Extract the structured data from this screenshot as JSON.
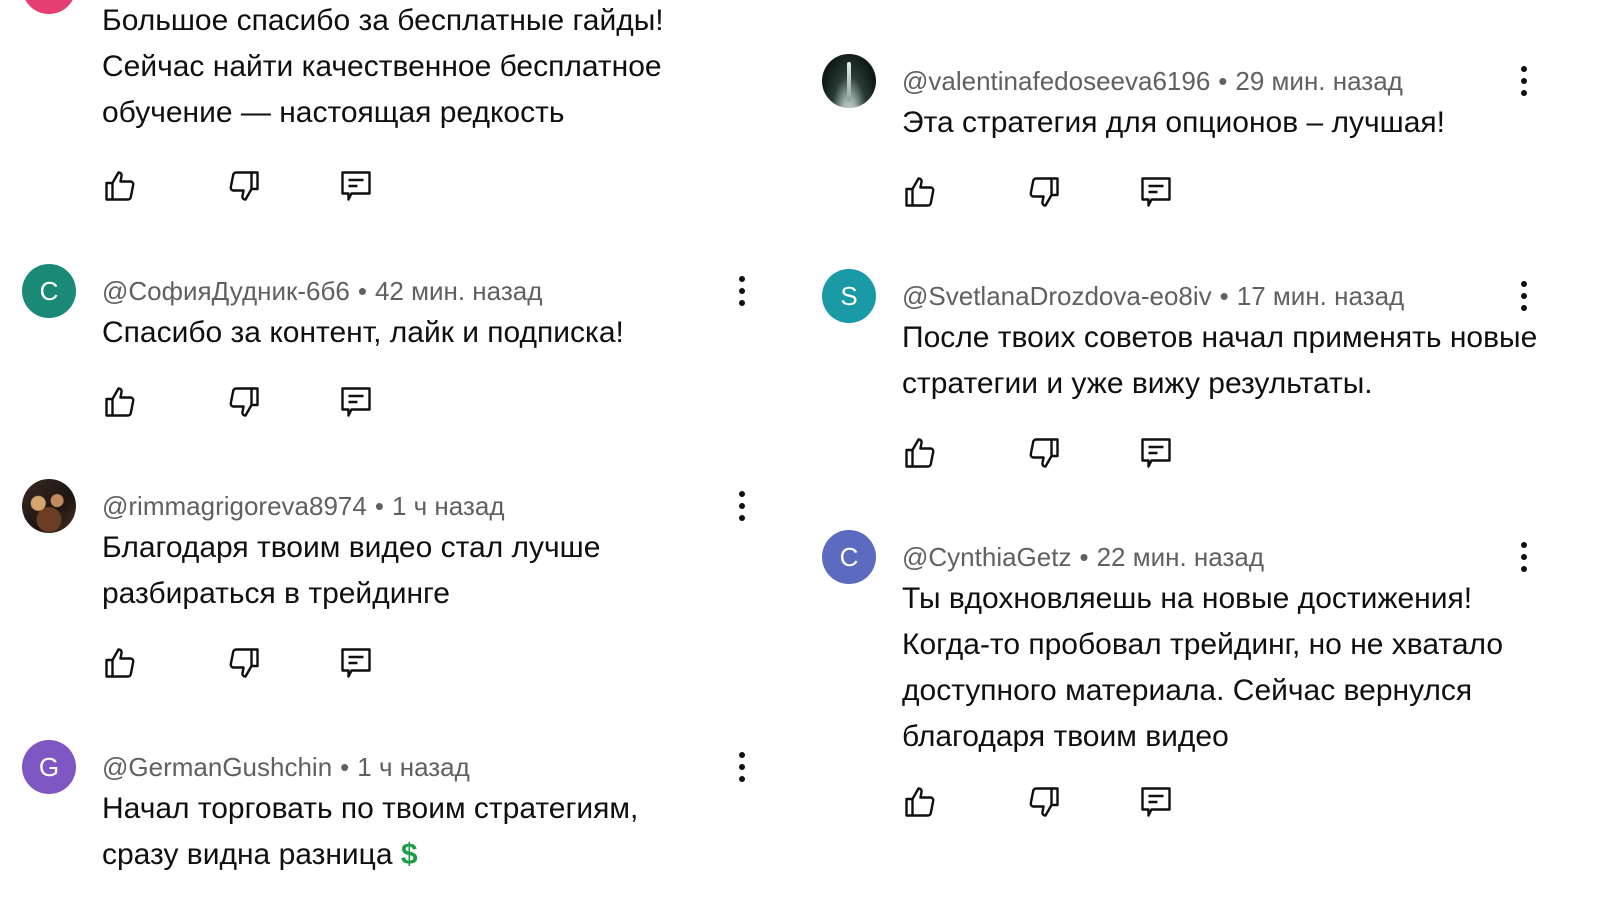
{
  "colors": {
    "avatar_sofia": "#1a8a76",
    "avatar_svetlana": "#1a9aa6",
    "avatar_cynthia": "#5c6bc0",
    "avatar_german": "#7e57c2",
    "avatar_top": "#e53e72"
  },
  "icons": {
    "like": "thumb-up-icon",
    "dislike": "thumb-down-icon",
    "reply": "reply-icon",
    "more": "more-vert-icon"
  },
  "comments_left": [
    {
      "author": "",
      "time": "",
      "avatar_letter": "",
      "text": "Большое спасибо за бесплатные гайды! Сейчас найти качественное бесплатное обучение — настоящая редкость"
    },
    {
      "author": "@СофияДудник-6б6",
      "time": "42 мин. назад",
      "avatar_letter": "С",
      "text": "Спасибо за контент, лайк и подписка!"
    },
    {
      "author": "@rimmagrigoreva8974",
      "time": "1 ч назад",
      "avatar_letter": "",
      "text": "Благодаря твоим видео стал лучше разбираться в трейдинге"
    },
    {
      "author": "@GermanGushchin",
      "time": "1 ч назад",
      "avatar_letter": "G",
      "text": "Начал торговать по твоим стратегиям, сразу видна разница",
      "emoji": "$"
    }
  ],
  "comments_right": [
    {
      "author": "@valentinafedoseeva6196",
      "time": "29 мин. назад",
      "avatar_letter": "",
      "text": "Эта стратегия для опционов – лучшая!"
    },
    {
      "author": "@SvetlanaDrozdova-eo8iv",
      "time": "17 мин. назад",
      "avatar_letter": "S",
      "text": "После твоих советов начал применять новые стратегии и уже вижу результаты."
    },
    {
      "author": "@CynthiaGetz",
      "time": "22 мин. назад",
      "avatar_letter": "C",
      "text": "Ты вдохновляешь на новые достижения! Когда-то пробовал трейдинг, но не хватало доступного материала. Сейчас вернулся благодаря твоим видео"
    }
  ]
}
